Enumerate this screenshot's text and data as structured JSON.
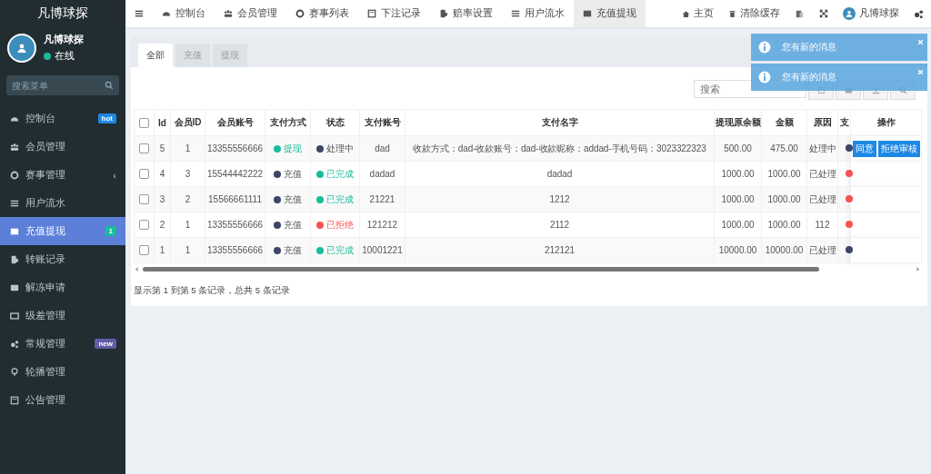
{
  "sidebar": {
    "brand": "凡博球探",
    "user": {
      "name": "凡博球探",
      "status": "在线",
      "online": true
    },
    "search": {
      "placeholder": "搜索菜单"
    },
    "items": [
      {
        "label": "控制台",
        "selected": false,
        "badge": {
          "text": "hot",
          "color": "#1e88e5"
        }
      },
      {
        "label": "会员管理",
        "selected": false
      },
      {
        "label": "赛事管理",
        "selected": false,
        "caret": "‹"
      },
      {
        "label": "用户流水",
        "selected": false
      },
      {
        "label": "充值提现",
        "selected": true,
        "badge": {
          "text": "1",
          "color": "#18bc9c"
        }
      },
      {
        "label": "转账记录",
        "selected": false
      },
      {
        "label": "解冻申请",
        "selected": false
      },
      {
        "label": "级差管理",
        "selected": false
      },
      {
        "label": "常规管理",
        "selected": false,
        "badge": {
          "text": "new",
          "color": "#605ca8"
        }
      },
      {
        "label": "轮播管理",
        "selected": false
      },
      {
        "label": "公告管理",
        "selected": false
      }
    ]
  },
  "topbar": {
    "tabs": [
      {
        "label": "控制台",
        "selected": false
      },
      {
        "label": "会员管理",
        "selected": false
      },
      {
        "label": "赛事列表",
        "selected": false
      },
      {
        "label": "下注记录",
        "selected": false
      },
      {
        "label": "赔率设置",
        "selected": false
      },
      {
        "label": "用户流水",
        "selected": false
      },
      {
        "label": "充值提现",
        "selected": true
      }
    ],
    "links": [
      "主页",
      "清除缓存"
    ],
    "user": "凡博球探"
  },
  "notifications": [
    {
      "text": "您有新的消息"
    },
    {
      "text": "您有新的消息"
    }
  ],
  "panel": {
    "tabs": [
      {
        "label": "全部",
        "selected": true
      },
      {
        "label": "充值",
        "selected": false
      },
      {
        "label": "提现",
        "selected": false
      }
    ],
    "search": {
      "placeholder": "搜索"
    },
    "table": {
      "select_all_checked": false,
      "columns": [
        "Id",
        "会员ID",
        "会员账号",
        "支付方式",
        "状态",
        "支付账号",
        "支付名字",
        "提现原余额",
        "金额",
        "原因",
        "支",
        "操作"
      ],
      "rows": [
        {
          "checked": false,
          "id": "5",
          "member_id": "1",
          "account": "13355556666",
          "pay_method": {
            "text": "提现",
            "color": "#18bc9c"
          },
          "status": {
            "text": "处理中",
            "color": "#3d4566"
          },
          "pay_account": "dad",
          "pay_name": "收款方式：dad-收款账号：dad-收款昵称：addad-手机号码：3023322323",
          "balance": "500.00",
          "amount": "475.00",
          "reason": "处理中",
          "column_12": {
            "color": "#3d4566"
          },
          "actions": [
            {
              "label": "同意"
            },
            {
              "label": "拒绝审核"
            }
          ]
        },
        {
          "checked": false,
          "id": "4",
          "member_id": "3",
          "account": "15544442222",
          "pay_method": {
            "text": "充值",
            "color": "#3d4566"
          },
          "status": {
            "text": "已完成",
            "color": "#18bc9c"
          },
          "pay_account": "dadad",
          "pay_name": "dadad",
          "balance": "1000.00",
          "amount": "1000.00",
          "reason": "已处理",
          "column_12": {
            "color": "#f75353"
          }
        },
        {
          "checked": false,
          "id": "3",
          "member_id": "2",
          "account": "15566661111",
          "pay_method": {
            "text": "充值",
            "color": "#3d4566"
          },
          "status": {
            "text": "已完成",
            "color": "#18bc9c"
          },
          "pay_account": "21221",
          "pay_name": "1212",
          "balance": "1000.00",
          "amount": "1000.00",
          "reason": "已处理",
          "column_12": {
            "color": "#f75353"
          }
        },
        {
          "checked": false,
          "id": "2",
          "member_id": "1",
          "account": "13355556666",
          "pay_method": {
            "text": "充值",
            "color": "#3d4566"
          },
          "status": {
            "text": "已拒绝",
            "color": "#f75353"
          },
          "pay_account": "121212",
          "pay_name": "2112",
          "balance": "1000.00",
          "amount": "1000.00",
          "reason": "112",
          "column_12": {
            "color": "#f75353"
          }
        },
        {
          "checked": false,
          "id": "1",
          "member_id": "1",
          "account": "13355556666",
          "pay_method": {
            "text": "充值",
            "color": "#3d4566"
          },
          "status": {
            "text": "已完成",
            "color": "#18bc9c"
          },
          "pay_account": "10001221",
          "pay_name": "212121",
          "balance": "10000.00",
          "amount": "10000.00",
          "reason": "已处理",
          "column_12": {
            "color": "#3d4566"
          }
        }
      ]
    },
    "footer": "显示第 1 到第 5 条记录，总共 5 条记录"
  }
}
